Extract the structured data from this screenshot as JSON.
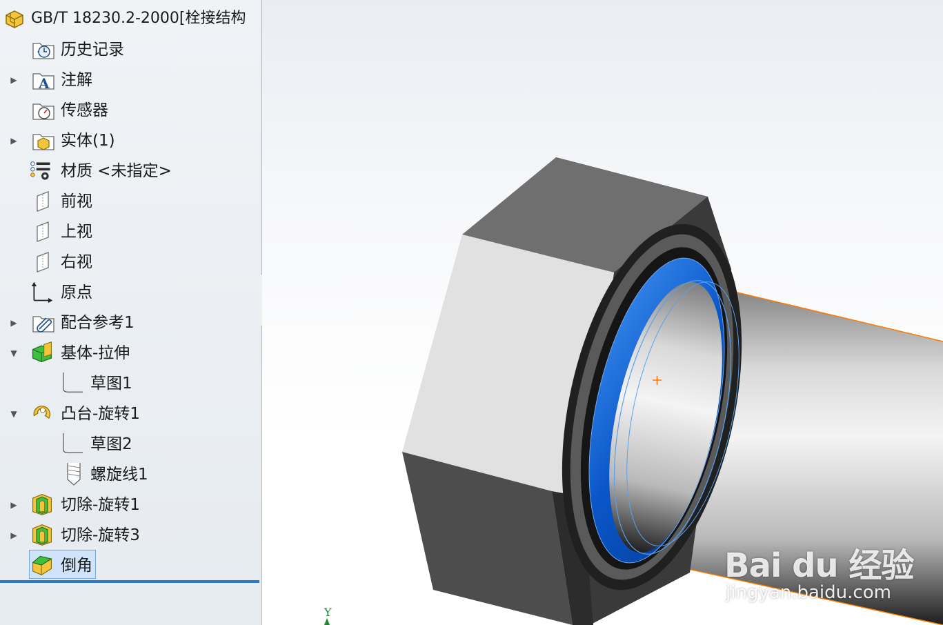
{
  "tree": {
    "title": "GB/T 18230.2-2000[栓接结构",
    "items": [
      {
        "label": "历史记录",
        "icon": "history-folder-icon"
      },
      {
        "label": "注解",
        "icon": "annotations-folder-icon"
      },
      {
        "label": "传感器",
        "icon": "sensors-folder-icon"
      },
      {
        "label": "实体(1)",
        "icon": "solid-bodies-folder-icon"
      },
      {
        "label": "材质 <未指定>",
        "icon": "material-icon"
      },
      {
        "label": "前视",
        "icon": "front-plane-icon"
      },
      {
        "label": "上视",
        "icon": "top-plane-icon"
      },
      {
        "label": "右视",
        "icon": "right-plane-icon"
      },
      {
        "label": "原点",
        "icon": "origin-icon"
      },
      {
        "label": "配合参考1",
        "icon": "mate-reference-icon"
      },
      {
        "label": "基体-拉伸",
        "icon": "extrude-feature-icon"
      },
      {
        "label": "草图1",
        "icon": "sketch-icon"
      },
      {
        "label": "凸台-旋转1",
        "icon": "revolve-boss-icon"
      },
      {
        "label": "草图2",
        "icon": "sketch-icon"
      },
      {
        "label": "螺旋线1",
        "icon": "helix-icon"
      },
      {
        "label": "切除-旋转1",
        "icon": "revolve-cut-icon"
      },
      {
        "label": "切除-旋转3",
        "icon": "revolve-cut-icon"
      },
      {
        "label": "倒角",
        "icon": "chamfer-icon"
      }
    ]
  },
  "viewport": {
    "triad_axis": "Y",
    "watermark": {
      "main": "Bai du 经验",
      "sub": "jingyan.baidu.com"
    }
  },
  "colors": {
    "selection": "#cfe3fb",
    "rollback_bar": "#2f79c9",
    "highlight_edge": "#1e6fd0",
    "origin_mark": "#ff7b00"
  }
}
